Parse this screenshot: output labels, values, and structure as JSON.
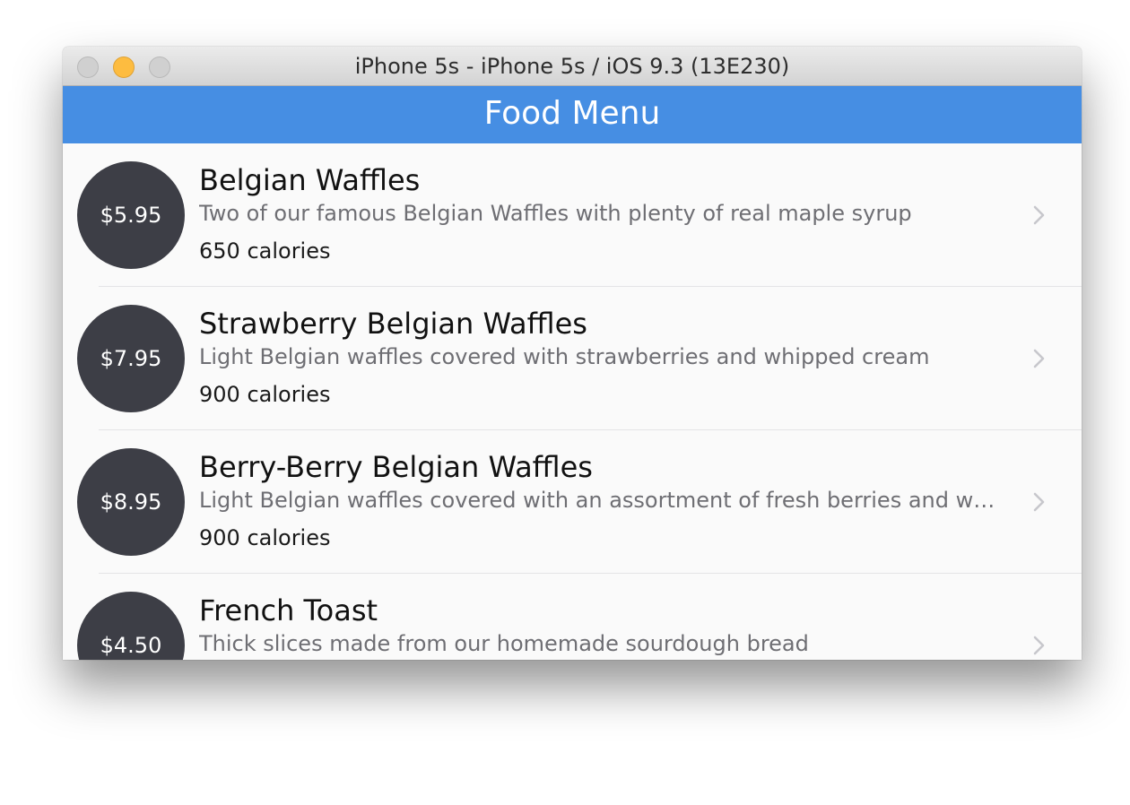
{
  "window": {
    "title": "iPhone 5s - iPhone 5s / iOS 9.3 (13E230)"
  },
  "navbar": {
    "title": "Food Menu"
  },
  "menu_items": [
    {
      "price": "$5.95",
      "name": "Belgian Waffles",
      "description": "Two of our famous Belgian Waffles with plenty of real maple syrup",
      "calories": "650 calories"
    },
    {
      "price": "$7.95",
      "name": "Strawberry Belgian Waffles",
      "description": "Light Belgian waffles covered with strawberries and whipped cream",
      "calories": "900 calories"
    },
    {
      "price": "$8.95",
      "name": "Berry-Berry Belgian Waffles",
      "description": "Light Belgian waffles covered with an assortment of fresh berries and whi…",
      "calories": "900 calories"
    },
    {
      "price": "$4.50",
      "name": "French Toast",
      "description": "Thick slices made from our homemade sourdough bread",
      "calories": ""
    }
  ],
  "icons": {
    "row_accessory": "chevron-right-icon"
  },
  "colors": {
    "navbar": "#468ee3",
    "price_circle": "#3d3e46",
    "minimize_button": "#fdbc40"
  }
}
